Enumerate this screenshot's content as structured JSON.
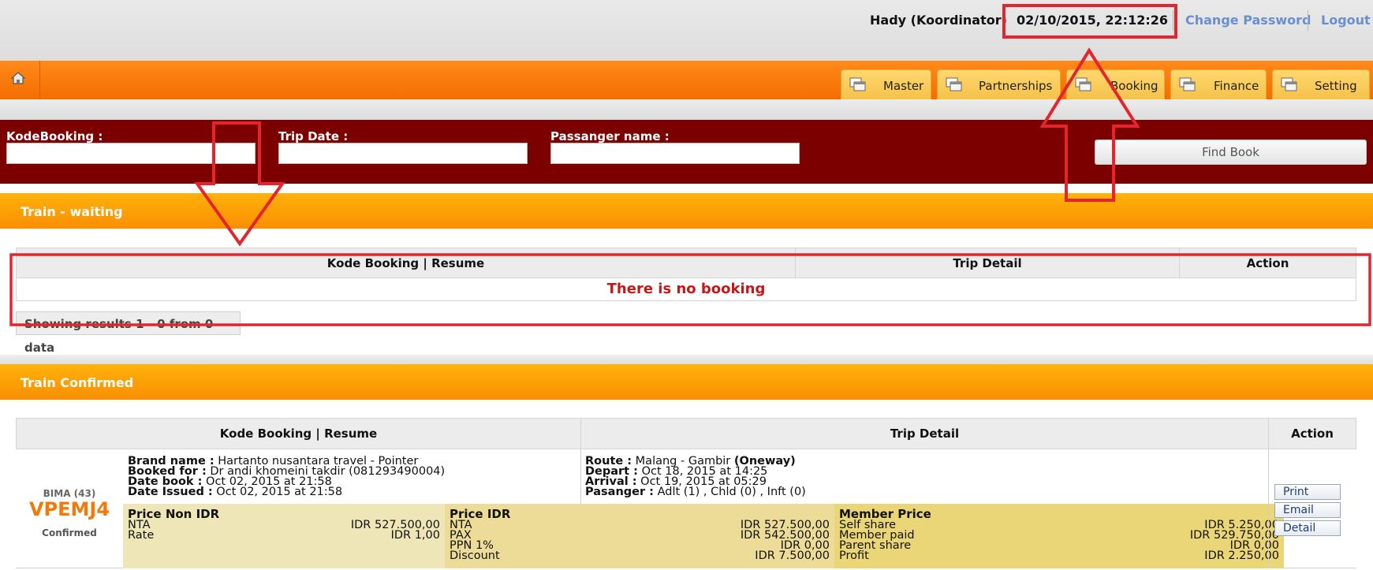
{
  "header": {
    "user": "Hady (Koordinator)",
    "datetime": "02/10/2015, 22:12:26",
    "change_password": "Change Password",
    "logout": "Logout"
  },
  "nav": {
    "home_icon": "home-icon",
    "tabs": [
      {
        "label": "Master",
        "icon": "window-icon"
      },
      {
        "label": "Partnerships",
        "icon": "window-icon"
      },
      {
        "label": "Booking",
        "icon": "window-icon"
      },
      {
        "label": "Finance",
        "icon": "window-icon"
      },
      {
        "label": "Setting",
        "icon": "window-icon"
      }
    ]
  },
  "search": {
    "kode_label": "KodeBooking :",
    "trip_label": "Trip Date :",
    "passenger_label": "Passanger name :",
    "kode_value": "",
    "trip_value": "",
    "passenger_value": "",
    "find_button": "Find Book"
  },
  "waiting": {
    "title": "Train - waiting",
    "columns": [
      "Kode Booking | Resume",
      "Trip Detail",
      "Action"
    ],
    "empty_message": "There is no booking",
    "showing": "Showing results 1 - 0 from 0 data"
  },
  "confirmed": {
    "title": "Train Confirmed",
    "columns": [
      "Kode Booking | Resume",
      "Trip Detail",
      "Action"
    ],
    "booking": {
      "provider": "BIMA (43)",
      "code": "VPEMJ4",
      "status": "Confirmed",
      "brand_label": "Brand name :",
      "brand_value": "Hartanto nusantara travel - Pointer",
      "booked_for_label": "Booked for :",
      "booked_for_value": "Dr andi khomeini takdir (081293490004)",
      "date_book_label": "Date book :",
      "date_book_value": "Oct 02, 2015 at 21:58",
      "date_issued_label": "Date Issued :",
      "date_issued_value": "Oct 02, 2015 at 21:58",
      "route_label": "Route :",
      "route_value": "Malang - Gambir",
      "route_type": "(Oneway)",
      "depart_label": "Depart :",
      "depart_value": "Oct 18, 2015 at 14:25",
      "arrival_label": "Arrival :",
      "arrival_value": "Oct 19, 2015 at 05:29",
      "passenger_label": "Pasanger :",
      "passenger_value": "Adlt (1) , Chld (0) , Inft (0)",
      "price_non_idr": {
        "title": "Price Non IDR",
        "rows": [
          {
            "label": "NTA",
            "value": "IDR 527.500,00"
          },
          {
            "label": "Rate",
            "value": "IDR 1,00"
          }
        ]
      },
      "price_idr": {
        "title": "Price IDR",
        "rows": [
          {
            "label": "NTA",
            "value": "IDR 527.500,00"
          },
          {
            "label": "PAX",
            "value": "IDR 542.500,00"
          },
          {
            "label": "PPN 1%",
            "value": "IDR 0,00"
          },
          {
            "label": "Discount",
            "value": "IDR 7.500,00"
          }
        ]
      },
      "member_price": {
        "title": "Member Price",
        "rows": [
          {
            "label": "Self share",
            "value": "IDR 5.250,00"
          },
          {
            "label": "Member paid",
            "value": "IDR 529.750,00"
          },
          {
            "label": "Parent share",
            "value": "IDR 0,00"
          },
          {
            "label": "Profit",
            "value": "IDR 2.250,00"
          }
        ]
      },
      "actions": [
        "Print",
        "Email",
        "Detail"
      ]
    }
  },
  "colors": {
    "accent_orange": "#f56d00",
    "search_bg": "#7d0000",
    "annotation_red": "#e3262d",
    "link_blue": "#6a8fd0"
  }
}
